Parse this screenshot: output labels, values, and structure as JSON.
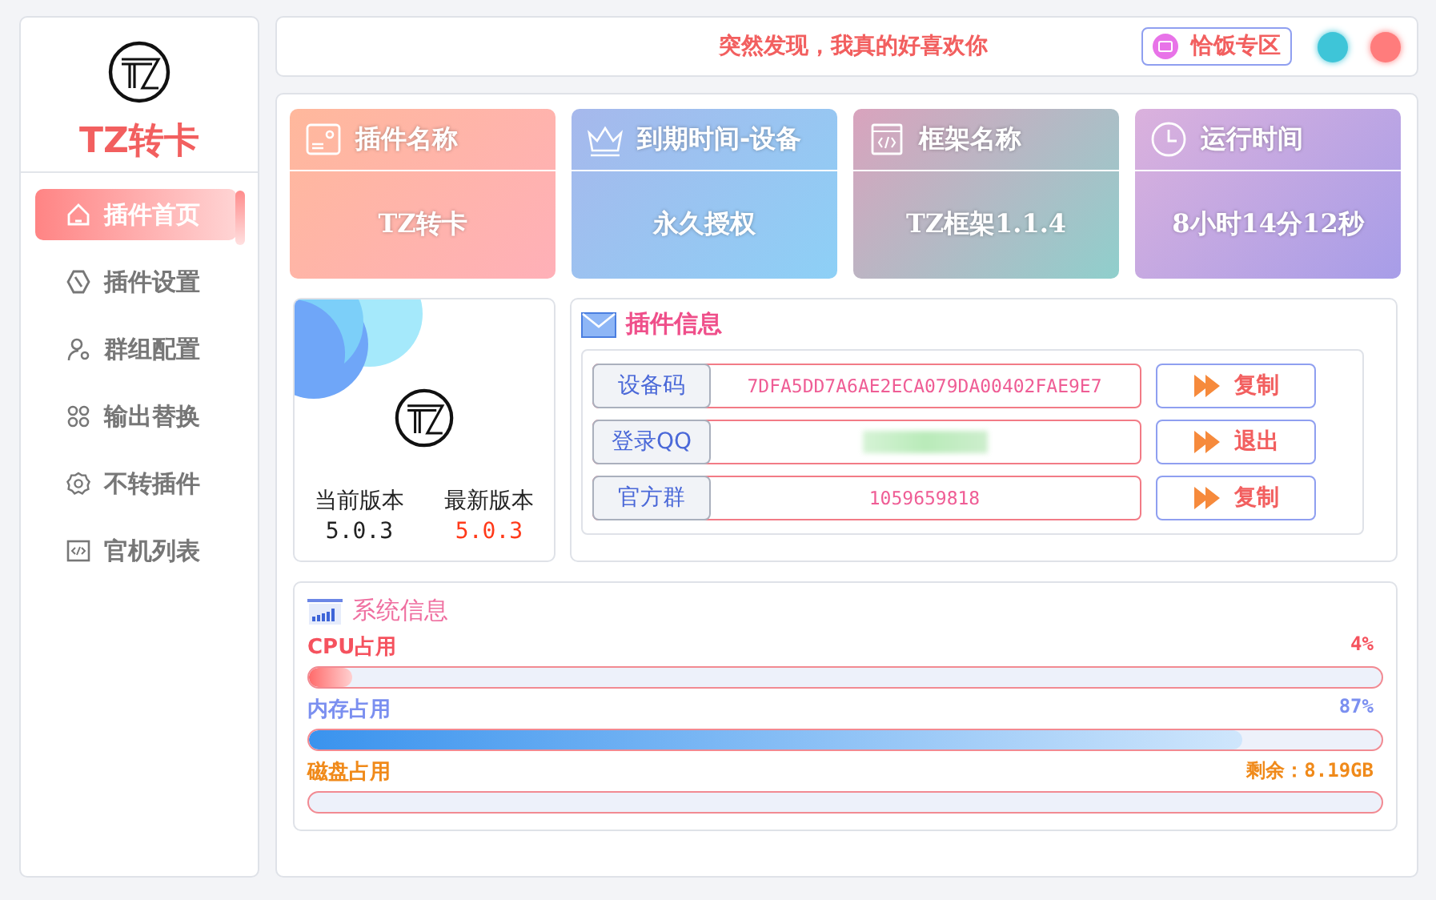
{
  "sidebar": {
    "logo_text": "TZ转卡",
    "items": [
      {
        "label": "插件首页",
        "kind": "home",
        "selected": true
      },
      {
        "label": "插件设置",
        "kind": "hexagon",
        "selected": false
      },
      {
        "label": "群组配置",
        "kind": "user",
        "selected": false
      },
      {
        "label": "输出替换",
        "kind": "grid",
        "selected": false
      },
      {
        "label": "不转插件",
        "kind": "gear",
        "selected": false
      },
      {
        "label": "官机列表",
        "kind": "code",
        "selected": false
      }
    ]
  },
  "top_bar": {
    "message": "突然发现，我真的好喜欢你",
    "ad_button": "恰饭专区"
  },
  "stat_cards": [
    {
      "title": "插件名称",
      "value": "TZ转卡",
      "kind": "card"
    },
    {
      "title": "到期时间-设备",
      "value": "永久授权",
      "kind": "crown"
    },
    {
      "title": "框架名称",
      "value": "TZ框架1.1.4",
      "kind": "code"
    },
    {
      "title": "运行时间",
      "value": "8小时14分12秒",
      "kind": "clock"
    }
  ],
  "version": {
    "current_label": "当前版本",
    "current": "5.0.3",
    "latest_label": "最新版本",
    "latest": "5.0.3"
  },
  "plugin_info": {
    "title": "插件信息",
    "rows": [
      {
        "label": "设备码",
        "kind": "text",
        "value": "7DFA5DD7A6AE2ECA079DA00402FAE9E7",
        "button": "复制"
      },
      {
        "label": "登录QQ",
        "kind": "blurred",
        "button": "退出"
      },
      {
        "label": "官方群",
        "kind": "text",
        "value": "1059659818",
        "button": "复制"
      }
    ]
  },
  "system_info": {
    "title": "系统信息",
    "meters": [
      {
        "label": "CPU占用",
        "reading": "4%",
        "level": 0.04,
        "color": "#f5525e",
        "kind": "red"
      },
      {
        "label": "内存占用",
        "reading": "87%",
        "level": 0.87,
        "color": "#7b8ff0",
        "kind": "blue"
      },
      {
        "label": "磁盘占用",
        "reading": "剩余：8.19GB",
        "level": 0,
        "color": "#f08a1a",
        "kind": "orange"
      }
    ]
  }
}
